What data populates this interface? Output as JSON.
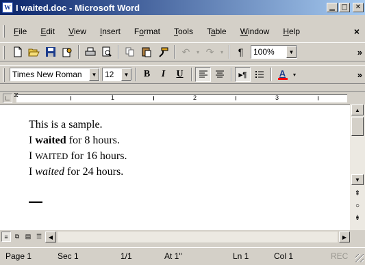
{
  "window": {
    "title": "I waited.doc - Microsoft Word",
    "app_icon_glyph": "W"
  },
  "menu": {
    "items": [
      {
        "label": "File",
        "access": "F"
      },
      {
        "label": "Edit",
        "access": "E"
      },
      {
        "label": "View",
        "access": "V"
      },
      {
        "label": "Insert",
        "access": "I"
      },
      {
        "label": "Format",
        "access": "o"
      },
      {
        "label": "Tools",
        "access": "T"
      },
      {
        "label": "Table",
        "access": "a"
      },
      {
        "label": "Window",
        "access": "W"
      },
      {
        "label": "Help",
        "access": "H"
      }
    ],
    "close_glyph": "×"
  },
  "standard_toolbar": {
    "zoom": "100%",
    "pilcrow_glyph": "¶"
  },
  "formatting_toolbar": {
    "font": "Times New Roman",
    "size": "12",
    "bold_glyph": "B",
    "italic_glyph": "I",
    "underline_glyph": "U",
    "font_color_glyph": "A"
  },
  "ruler": {
    "numbers": [
      "1",
      "2",
      "3"
    ]
  },
  "document": {
    "line1": "This is a sample.",
    "line2_pre": "I ",
    "line2_bold": "waited",
    "line2_post": " for 8 hours.",
    "line3_pre": "I ",
    "line3_caps": "WAITED",
    "line3_post": " for 16 hours.",
    "line4_pre": "I ",
    "line4_italic": "waited",
    "line4_post": " for 24 hours."
  },
  "status": {
    "page": "Page 1",
    "section": "Sec 1",
    "page_of": "1/1",
    "at": "At 1\"",
    "line": "Ln 1",
    "col": "Col 1",
    "rec": "REC"
  },
  "icons": {
    "new": "new-document-icon",
    "open": "open-folder-icon",
    "save": "save-disk-icon",
    "permission": "permission-icon",
    "print": "print-icon",
    "preview": "print-preview-icon",
    "copy": "copy-icon",
    "paste": "paste-icon",
    "format_painter": "format-painter-icon",
    "undo": "undo-icon",
    "redo": "redo-icon"
  },
  "colors": {
    "title_start": "#0a246a",
    "title_end": "#a6caf0",
    "font_color_bar": "#ff0000",
    "chrome": "#d4d0c8"
  }
}
